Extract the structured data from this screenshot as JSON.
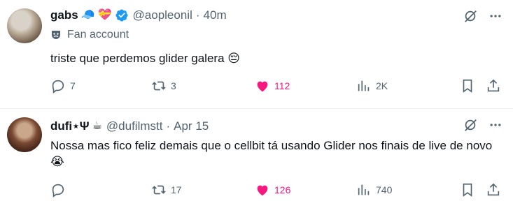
{
  "tweets": [
    {
      "name": "gabs",
      "name_emojis": [
        "🧢",
        "💝"
      ],
      "handle": "@aopleonil",
      "time": "40m",
      "label": "Fan account",
      "text": "triste que perdemos glider galera 😔",
      "replies": "7",
      "reposts": "3",
      "likes": "112",
      "views": "2K",
      "verified": true,
      "liked": true
    },
    {
      "name": "dufi⋆Ψ",
      "name_emojis": [
        "☕"
      ],
      "handle": "@dufilmstt",
      "time": "Apr 15",
      "text": "Nossa mas fico feliz demais que o cellbit tá usando Glider nos finais de live de novo 😭",
      "replies": "",
      "reposts": "17",
      "likes": "126",
      "views": "740",
      "verified": false,
      "liked": true
    }
  ],
  "colors": {
    "text": "#0f1419",
    "secondary": "#536471",
    "like": "#f91880",
    "verified": "#1d9bf0",
    "divider": "#eff3f4"
  },
  "icons": {
    "reply": "reply-icon",
    "repost": "repost-icon",
    "like": "heart-icon",
    "views": "views-icon",
    "bookmark": "bookmark-icon",
    "share": "share-icon",
    "grok": "grok-icon",
    "more": "more-icon"
  }
}
